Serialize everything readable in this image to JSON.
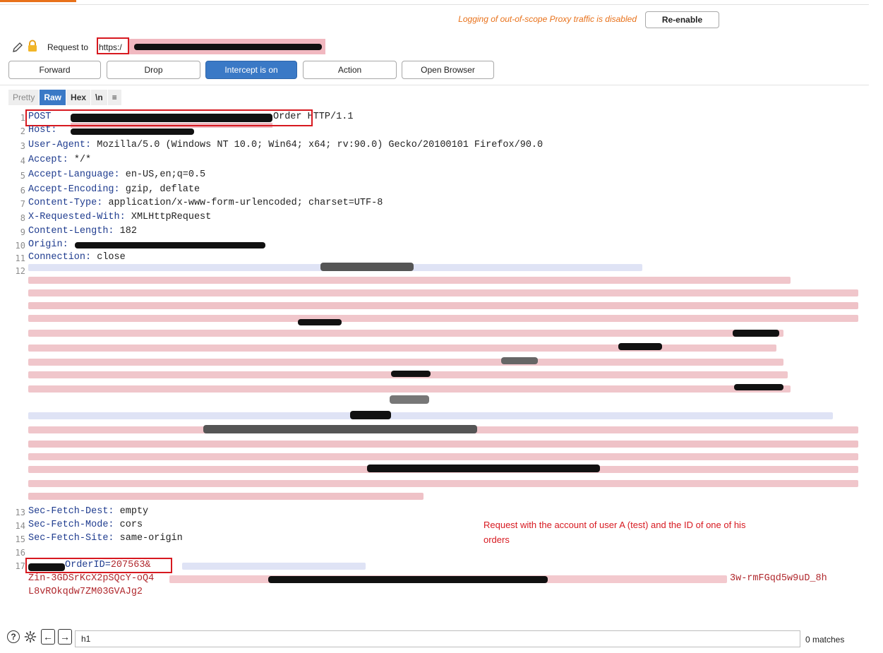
{
  "topbar": {
    "notice": "Logging of out-of-scope Proxy traffic is disabled",
    "reenable_label": "Re-enable"
  },
  "request": {
    "label": "Request to",
    "url": "https:/"
  },
  "toolbar": {
    "forward": "Forward",
    "drop": "Drop",
    "intercept": "Intercept is on",
    "action": "Action",
    "open_browser": "Open Browser"
  },
  "view_tabs": {
    "pretty": "Pretty",
    "raw": "Raw",
    "hex": "Hex",
    "newline": "\\n",
    "menu": "≡"
  },
  "lines": [
    {
      "n": "1",
      "name": "POST",
      "value": "Order HTTP/1.1"
    },
    {
      "n": "2",
      "name": "Host:",
      "value": ""
    },
    {
      "n": "3",
      "name": "User-Agent:",
      "value": "Mozilla/5.0 (Windows NT 10.0; Win64; x64; rv:90.0) Gecko/20100101 Firefox/90.0"
    },
    {
      "n": "4",
      "name": "Accept:",
      "value": "*/*"
    },
    {
      "n": "5",
      "name": "Accept-Language:",
      "value": "en-US,en;q=0.5"
    },
    {
      "n": "6",
      "name": "Accept-Encoding:",
      "value": "gzip, deflate"
    },
    {
      "n": "7",
      "name": "Content-Type:",
      "value": "application/x-www-form-urlencoded; charset=UTF-8"
    },
    {
      "n": "8",
      "name": "X-Requested-With:",
      "value": "XMLHttpRequest"
    },
    {
      "n": "9",
      "name": "Content-Length:",
      "value": "182"
    },
    {
      "n": "10",
      "name": "Origin:",
      "value": ""
    },
    {
      "n": "11",
      "name": "Connection:",
      "value": "close"
    },
    {
      "n": "12",
      "name": "",
      "value": ""
    },
    {
      "n": "13",
      "name": "Sec-Fetch-Dest:",
      "value": "empty"
    },
    {
      "n": "14",
      "name": "Sec-Fetch-Mode:",
      "value": "cors"
    },
    {
      "n": "15",
      "name": "Sec-Fetch-Site:",
      "value": "same-origin"
    },
    {
      "n": "16",
      "name": "",
      "value": ""
    },
    {
      "n": "17",
      "name": "OrderID=",
      "value": "207563&"
    }
  ],
  "body_continuation": [
    {
      "left": "Zin-3GDSrKcX2pSQcY-oQ4",
      "right": "3w-rmFGqd5w9uD_8h"
    },
    {
      "left": "L8vROkqdw7ZM03GVAJg2",
      "right": ""
    }
  ],
  "annotation": "Request with the account of user A (test) and the ID of one of his orders",
  "search": {
    "value": "h1",
    "matches": "0 matches"
  },
  "icons": {
    "edit": "pencil-icon",
    "lock": "lock-icon",
    "help": "help-icon",
    "settings": "gear-icon",
    "back": "arrow-left-icon",
    "forward": "arrow-right-icon"
  },
  "colors": {
    "accent_orange": "#e8711a",
    "intercept_blue": "#3a79c6",
    "highlight_red": "#d71920",
    "header_name": "#1f3c8f"
  }
}
